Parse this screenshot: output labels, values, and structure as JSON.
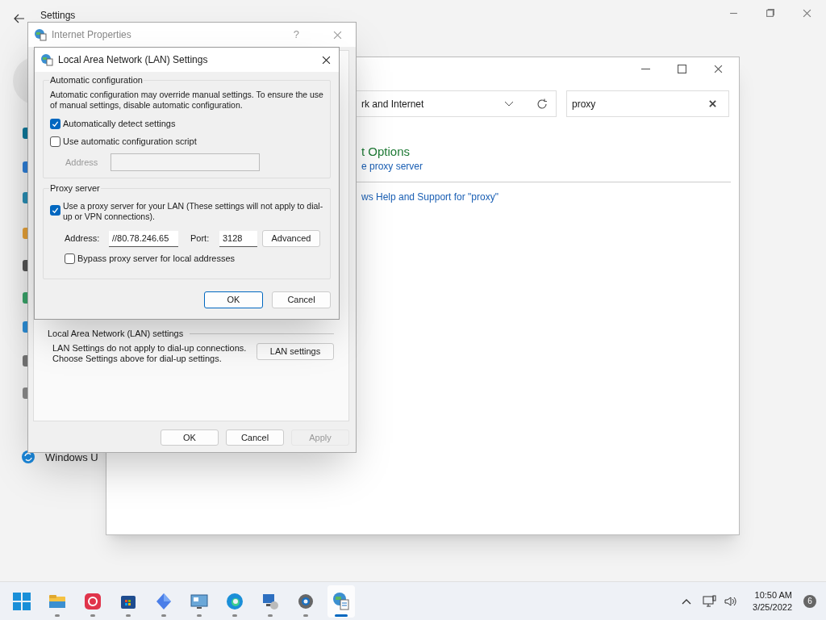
{
  "settings_window": {
    "title": "Settings",
    "sidebar_items": [
      {
        "label": "Windows U"
      }
    ]
  },
  "control_panel": {
    "address": "rk and Internet",
    "search": {
      "value": "proxy"
    },
    "result_title": "t Options",
    "result_link": "e proxy server",
    "help_link": "ws Help and Support for \"proxy\""
  },
  "internet_properties": {
    "title": "Internet Properties",
    "help": "?",
    "lan_group": {
      "title": "Local Area Network (LAN) settings",
      "text": "LAN Settings do not apply to dial-up connections.\nChoose Settings above for dial-up settings.",
      "button": "LAN settings"
    },
    "buttons": [
      {
        "label": "OK",
        "disabled": false
      },
      {
        "label": "Cancel",
        "disabled": false
      },
      {
        "label": "Apply",
        "disabled": true
      }
    ]
  },
  "lan_dialog": {
    "title": "Local Area Network (LAN) Settings",
    "auto_group": {
      "title": "Automatic configuration",
      "text": "Automatic configuration may override manual settings.  To ensure the use of manual settings, disable automatic configuration.",
      "options": [
        {
          "label": "Automatically detect settings",
          "checked": true
        },
        {
          "label": "Use automatic configuration script",
          "checked": false
        }
      ],
      "address": {
        "label": "Address",
        "disabled": true
      }
    },
    "proxy_group": {
      "title": "Proxy server",
      "use_proxy": {
        "label": "Use a proxy server for your LAN (These settings will not apply to dial-up or VPN connections).",
        "checked": true
      },
      "address": {
        "label": "Address:",
        "value": "//80.78.246.65"
      },
      "port": {
        "label": "Port:",
        "value": "3128"
      },
      "advanced": "Advanced",
      "bypass": {
        "label": "Bypass proxy server for local addresses",
        "checked": false
      }
    },
    "buttons": [
      {
        "label": "OK",
        "default": true
      },
      {
        "label": "Cancel",
        "default": false
      }
    ]
  },
  "taskbar": {
    "apps": [
      {
        "active": false
      },
      {
        "active": false
      },
      {
        "active": false
      },
      {
        "active": false
      },
      {
        "active": false
      },
      {
        "active": false
      },
      {
        "active": false
      },
      {
        "active": false
      },
      {
        "active": true
      }
    ],
    "time": "10:50 AM",
    "date": "3/25/2022",
    "notifications": "6"
  }
}
